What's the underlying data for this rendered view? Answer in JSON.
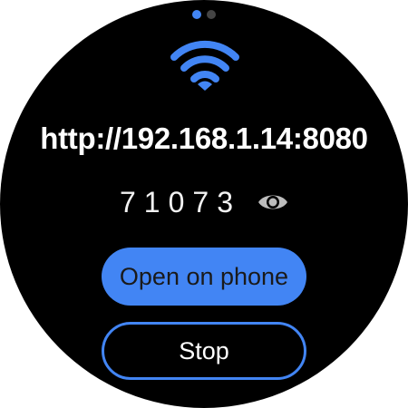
{
  "pager": {
    "total": 2,
    "active": 0,
    "active_color": "#4285f4",
    "inactive_color": "#444444"
  },
  "status_icon": "wifi-icon",
  "server": {
    "url": "http://192.168.1.14:8080",
    "code": "71073"
  },
  "toggle_visibility_icon": "eye-icon",
  "buttons": {
    "open_label": "Open on phone",
    "stop_label": "Stop"
  },
  "colors": {
    "accent": "#4285f4",
    "background": "#000000",
    "text": "#ffffff",
    "icon_muted": "#bdbdbd"
  }
}
